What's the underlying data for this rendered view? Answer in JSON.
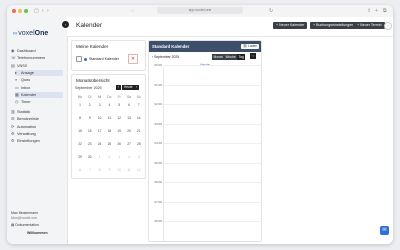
{
  "browser": {
    "url": "app.voxtel.one"
  },
  "app": {
    "brand_prefix": "voxel",
    "brand_suffix": "One",
    "page_title": "Kalender"
  },
  "sidebar": {
    "items": [
      {
        "label": "Dashboard",
        "icon": "dashboard-icon",
        "glyph": "◉"
      },
      {
        "label": "Telefonnummern",
        "icon": "phone-icon",
        "glyph": "☏"
      },
      {
        "label": "VNSX",
        "icon": "server-icon",
        "glyph": "▤"
      },
      {
        "label": "Ansage",
        "icon": "speaker-icon",
        "glyph": "▸",
        "sub": true,
        "selected": true
      },
      {
        "label": "Queu",
        "icon": "queue-icon",
        "glyph": "≡",
        "sub": true
      },
      {
        "label": "Inbox",
        "icon": "inbox-icon",
        "glyph": "▭",
        "sub": true
      },
      {
        "label": "Kalender",
        "icon": "calendar-icon",
        "glyph": "▦",
        "sub": true,
        "selected": true
      },
      {
        "label": "Timer",
        "icon": "timer-icon",
        "glyph": "◷",
        "sub": true
      },
      {
        "label": "Statistik",
        "icon": "chart-icon",
        "glyph": "▥"
      },
      {
        "label": "Benutzerliste",
        "icon": "users-icon",
        "glyph": "☰"
      },
      {
        "label": "Automation",
        "icon": "automation-icon",
        "glyph": "⟳"
      },
      {
        "label": "Verwaltung",
        "icon": "admin-icon",
        "glyph": "⚙"
      },
      {
        "label": "Einstellungen",
        "icon": "settings-icon",
        "glyph": "⚙"
      }
    ],
    "footer": {
      "line1": "Max Mustermann",
      "line2": "Max@voxtel.one",
      "docs": "Dokumentation",
      "user": "Willkommen"
    }
  },
  "topbar": {
    "buttons": [
      "+ Neuer Kalender",
      "+ Buchungseinstellungen",
      "+ Neuer Termin"
    ]
  },
  "my_calendars": {
    "title": "Meine Kalender",
    "items": [
      {
        "label": "Standard Kalender",
        "checked": true
      }
    ]
  },
  "month_overview": {
    "title": "Monatsübersicht",
    "month_label": "September 2025",
    "today_label": "Heute",
    "weekdays": [
      "Mo",
      "Di",
      "Mi",
      "Do",
      "Fr",
      "Sa",
      "So"
    ],
    "weeks": [
      [
        "1",
        "2",
        "3",
        "4",
        "5",
        "6",
        "7"
      ],
      [
        "8",
        "9",
        "10",
        "11",
        "12",
        "13",
        "14"
      ],
      [
        "15",
        "16",
        "17",
        "18",
        "19",
        "20",
        "21"
      ],
      [
        "22",
        "23",
        "24",
        "25",
        "26",
        "27",
        "28"
      ],
      [
        "29",
        "30",
        "1",
        "2",
        "3",
        "4",
        "5"
      ],
      [
        "6",
        "7",
        "8",
        "9",
        "10",
        "11",
        "12"
      ]
    ]
  },
  "calendar": {
    "title": "Standard Kalender",
    "link_label": "Laden",
    "period_label": "September 2025",
    "views": [
      "Monat",
      "Woche",
      "Tag"
    ],
    "active_view": "Tag",
    "today_label": "Heute",
    "hours": [
      "00:00",
      "01:00",
      "02:00",
      "03:00",
      "04:00",
      "05:00",
      "06:00",
      "07:00",
      "08:00"
    ]
  },
  "colors": {
    "accent": "#3d4f6b",
    "brand": "#2d3e63",
    "help": "#2f6fd6"
  }
}
